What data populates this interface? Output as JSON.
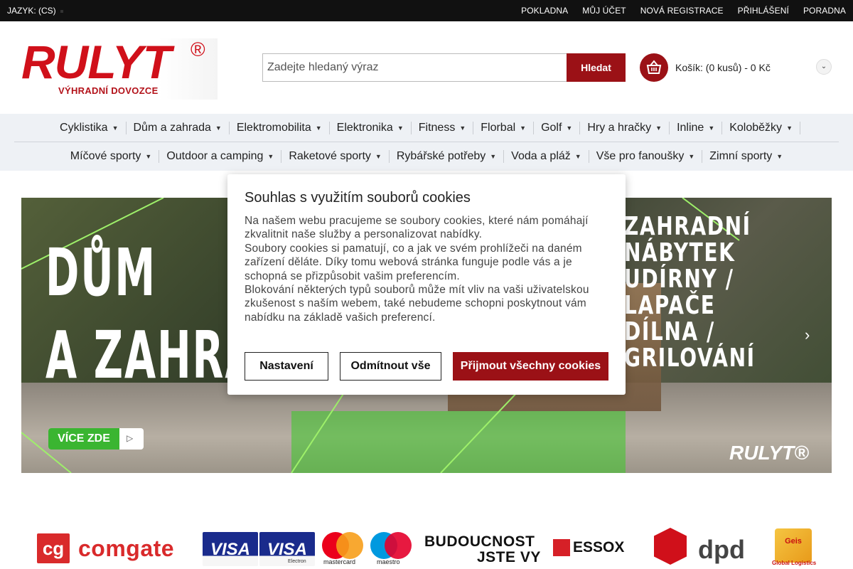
{
  "topbar": {
    "language": "JAZYK: (CS)",
    "links": [
      "POKLADNA",
      "MŮJ ÚČET",
      "NOVÁ REGISTRACE",
      "PŘIHLÁŠENÍ",
      "PORADNA"
    ]
  },
  "header": {
    "logo_text": "RULYT",
    "logo_reg": "®",
    "logo_tagline": "VÝHRADNÍ DOVOZCE",
    "search_placeholder": "Zadejte hledaný výraz",
    "search_button": "Hledat",
    "cart_text": "Košík: (0 kusů) - 0 Kč"
  },
  "nav": {
    "row1": [
      "Cyklistika",
      "Dům a zahrada",
      "Elektromobilita",
      "Elektronika",
      "Fitness",
      "Florbal",
      "Golf",
      "Hry a hračky",
      "Inline",
      "Koloběžky"
    ],
    "row2": [
      "Míčové sporty",
      "Outdoor a camping",
      "Raketové sporty",
      "Rybářské potřeby",
      "Voda a pláž",
      "Vše pro fanoušky",
      "Zimní sporty"
    ]
  },
  "banner": {
    "title_line1": "DŮM",
    "title_line2": "A ZAHRADA",
    "right_lines": [
      "ZAHRADNÍ NÁBYTEK",
      "UDÍRNY / LAPAČE",
      "DÍLNA / GRILOVÁNÍ"
    ],
    "cta": "VÍCE ZDE",
    "brand": "RULYT®"
  },
  "cookie": {
    "title": "Souhlas s využitím souborů cookies",
    "p1": "Na našem webu pracujeme se soubory cookies, které nám pomáhají zkvalitnit naše služby a personalizovat nabídky.",
    "p2": "Soubory cookies si pamatují, co a jak ve svém prohlížeči na daném zařízení děláte. Díky tomu webová stránka funguje podle vás a je schopná se přizpůsobit vašim preferencím.",
    "p3": "Blokování některých typů souborů může mít vliv na vaši uživatelskou zkušenost s naším webem, také nebudeme schopni poskytnout vám nabídku na základě vašich preferencí.",
    "btn_settings": "Nastavení",
    "btn_reject": "Odmítnout vše",
    "btn_accept": "Přijmout všechny cookies"
  },
  "payments": {
    "comgate_mark": "cg",
    "comgate_word": "comgate",
    "visa1": "VISA",
    "visa2": "VISA",
    "visa2_sub": "Electron",
    "mastercard": "mastercard",
    "maestro": "maestro",
    "essox_slogan1": "BUDOUCNOST",
    "essox_slogan2": "JSTE VY",
    "essox": "ESSOX",
    "dpd": "dpd",
    "geis": "Geis",
    "geis_sub": "Global Logistics"
  },
  "colors": {
    "brand_red": "#9b1116",
    "logo_red": "#d0101a",
    "topbar_bg": "#111111",
    "nav_bg": "#eef1f5",
    "cta_green": "#3ab531"
  }
}
